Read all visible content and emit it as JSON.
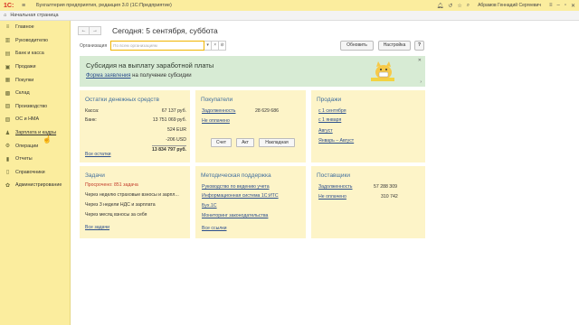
{
  "titlebar": {
    "logo": "1С:",
    "app_title": "Бухгалтерия предприятия, редакция 3.0   (1С:Предприятие)",
    "user_name": "Абрамов Геннадий Сергеевич"
  },
  "tabbar": {
    "home_label": "Начальная страница"
  },
  "sidebar": {
    "items": [
      {
        "label": "Главное",
        "icon": "home-icon"
      },
      {
        "label": "Руководителю",
        "icon": "chart-icon"
      },
      {
        "label": "Банк и касса",
        "icon": "bank-icon"
      },
      {
        "label": "Продажи",
        "icon": "cart-icon"
      },
      {
        "label": "Покупки",
        "icon": "basket-icon"
      },
      {
        "label": "Склад",
        "icon": "warehouse-icon"
      },
      {
        "label": "Производство",
        "icon": "factory-icon"
      },
      {
        "label": "ОС и НМА",
        "icon": "assets-icon"
      },
      {
        "label": "Зарплата и кадры",
        "icon": "people-icon"
      },
      {
        "label": "Операции",
        "icon": "operations-icon"
      },
      {
        "label": "Отчеты",
        "icon": "reports-icon"
      },
      {
        "label": "Справочники",
        "icon": "book-icon"
      },
      {
        "label": "Администрирование",
        "icon": "gear-icon"
      }
    ]
  },
  "nav": {
    "back": "←",
    "forward": "→",
    "title": "Сегодня: 5 сентября, суббота"
  },
  "toolbar": {
    "org_label": "Организация",
    "org_placeholder": "По всем организациям",
    "refresh_label": "Обновить",
    "settings_label": "Настройка",
    "help_label": "?"
  },
  "banner": {
    "title": "Субсидия на выплату заработной платы",
    "link": "Форма заявления",
    "tail": " на получение субсидии"
  },
  "cash": {
    "title": "Остатки денежных средств",
    "rows": [
      {
        "label": "Касса:",
        "value": "67 137 руб."
      },
      {
        "label": "Банк:",
        "value": "13 751 069 руб."
      },
      {
        "label": "",
        "value": "524 EUR"
      },
      {
        "label": "",
        "value": "-206 USD"
      }
    ],
    "total": "13 834 797 руб.",
    "all_link": "Все остатки"
  },
  "buyers": {
    "title": "Покупатели",
    "debt_label": "Задолженность",
    "debt_value": "28 629 686",
    "unpaid_label": "Не оплачено",
    "buttons": [
      "Счет",
      "Акт",
      "Накладная"
    ]
  },
  "sales": {
    "title": "Продажи",
    "links": [
      "с 1 сентября",
      "с 1 января",
      "Август",
      "Январь – Август"
    ]
  },
  "tasks": {
    "title": "Задачи",
    "overdue": "Просрочено: 851 задача",
    "rows": [
      "Через неделю страховые взносы и зарпл...",
      "Через 3 недели НДС и зарплата",
      "Через месяц взносы за себя"
    ],
    "all_link": "Все задачи"
  },
  "support": {
    "title": "Методическая поддержка",
    "links": [
      "Руководство по ведению учета",
      "Информационная система 1С:ИТС",
      "Бух.1С",
      "Мониторинг законодательства"
    ],
    "all_link": "Все ссылки"
  },
  "suppliers": {
    "title": "Поставщики",
    "debt_label": "Задолженность",
    "debt_value": "57 288 309",
    "unpaid_label": "Не оплачено",
    "unpaid_value": "310 742"
  },
  "colors": {
    "accent": "#fbed9e",
    "card": "#fdf4c8",
    "banner": "#d7ebd4",
    "link": "#2b4e8c",
    "title": "#406f9e",
    "overdue": "#c23b2a"
  }
}
